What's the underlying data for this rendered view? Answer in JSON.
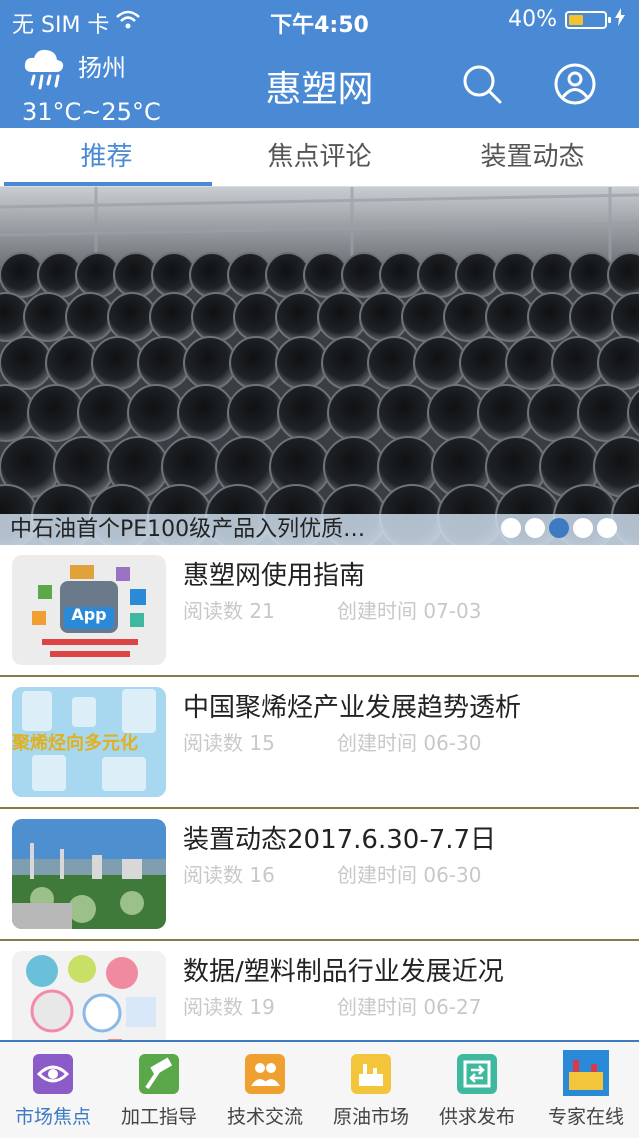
{
  "status_bar": {
    "carrier": "无 SIM 卡",
    "time": "下午4:50",
    "battery": "40%",
    "battery_level": 0.4
  },
  "header": {
    "city": "扬州",
    "temperature": "31°C~25°C",
    "title": "惠塑网",
    "weather_icon": "rain-cloud-icon"
  },
  "tabs": [
    {
      "label": "推荐",
      "active": true
    },
    {
      "label": "焦点评论",
      "active": false
    },
    {
      "label": "装置动态",
      "active": false
    }
  ],
  "banner": {
    "caption": "中石油首个PE100级产品入列优质…",
    "page_count": 5,
    "active_index": 2
  },
  "articles": [
    {
      "title": "惠塑网使用指南",
      "reads": "阅读数 21",
      "created": "创建时间 07-03",
      "thumb_text": "App"
    },
    {
      "title": "中国聚烯烃产业发展趋势透析",
      "reads": "阅读数 15",
      "created": "创建时间 06-30",
      "thumb_text": "聚烯烃向多元化"
    },
    {
      "title": "装置动态2017.6.30-7.7日",
      "reads": "阅读数 16",
      "created": "创建时间 06-30",
      "thumb_text": ""
    },
    {
      "title": "数据/塑料制品行业发展近况",
      "reads": "阅读数 19",
      "created": "创建时间 06-27",
      "thumb_text": ""
    }
  ],
  "bottom_nav": [
    {
      "label": "市场焦点",
      "active": true,
      "color": "#8b5cc7",
      "icon": "eye-icon"
    },
    {
      "label": "加工指导",
      "active": false,
      "color": "#5aa84a",
      "icon": "hammer-icon"
    },
    {
      "label": "技术交流",
      "active": false,
      "color": "#f0a030",
      "icon": "people-icon"
    },
    {
      "label": "原油市场",
      "active": false,
      "color": "#f2c53a",
      "icon": "oil-factory-icon"
    },
    {
      "label": "供求发布",
      "active": false,
      "color": "#3fb8a0",
      "icon": "exchange-icon"
    },
    {
      "label": "专家在线",
      "active": false,
      "color": "#2a8ad8",
      "icon": "expert-icon"
    }
  ],
  "colors": {
    "brand": "#4a8ad5",
    "accent": "#3d7ac2"
  }
}
